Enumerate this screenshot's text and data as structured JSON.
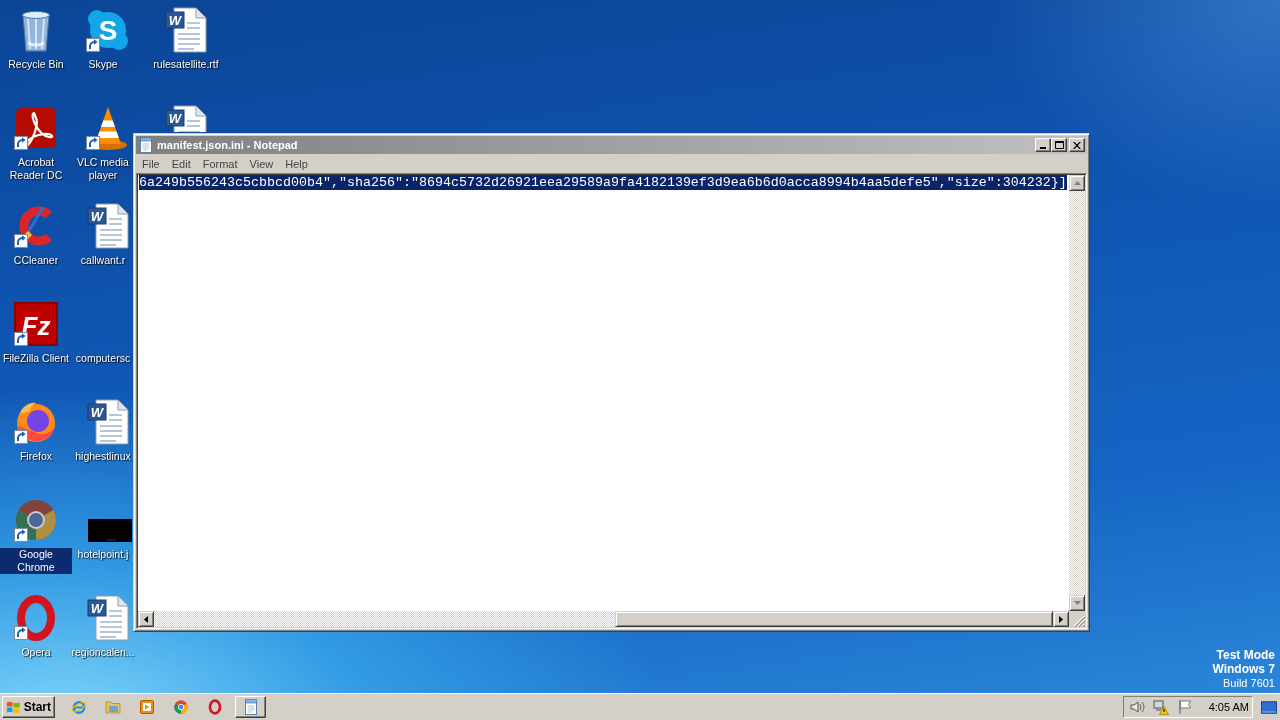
{
  "desktop": {
    "columns": [
      [
        {
          "label": "Recycle Bin",
          "selected": false,
          "shortcut": false
        },
        {
          "label": "Acrobat Reader DC",
          "selected": false,
          "shortcut": true
        },
        {
          "label": "CCleaner",
          "selected": false,
          "shortcut": true
        },
        {
          "label": "FileZilla Client",
          "selected": false,
          "shortcut": true,
          "logo_text": "Fz"
        },
        {
          "label": "Firefox",
          "selected": false,
          "shortcut": true
        },
        {
          "label": "Google Chrome",
          "selected": true,
          "shortcut": true
        },
        {
          "label": "Opera",
          "selected": false,
          "shortcut": true
        }
      ],
      [
        {
          "label": "Skype",
          "selected": false,
          "shortcut": true,
          "logo_text": "S"
        },
        {
          "label": "VLC media player",
          "selected": false,
          "shortcut": true
        },
        {
          "label": "callwant.r",
          "selected": false,
          "shortcut": false,
          "logo_text": "W"
        },
        {
          "label": "computersc",
          "selected": false,
          "shortcut": false
        },
        {
          "label": "highestlinux",
          "selected": false,
          "shortcut": false,
          "logo_text": "W"
        },
        {
          "label": "hotelpoint.j",
          "selected": false,
          "shortcut": false
        },
        {
          "label": "regioncalen...",
          "selected": false,
          "shortcut": false,
          "logo_text": "W"
        }
      ],
      [
        {
          "label": "rulesatellite.rtf",
          "selected": false,
          "shortcut": false,
          "logo_text": "W"
        },
        {
          "selected": false,
          "shortcut": false,
          "logo_text": "W"
        }
      ]
    ],
    "notice": {
      "title_lines": [
        "Test Mode",
        "Windows 7"
      ],
      "build": "Build 7601"
    }
  },
  "window": {
    "title": "manifest.json.ini - Notepad",
    "active": false,
    "menu": [
      "File",
      "Edit",
      "Format",
      "View",
      "Help"
    ],
    "lines": [
      {
        "text": "6a249b556243c5cbbcd00b4\",\"sha256\":\"8694c5732d26921eea29589a9fa4182139ef3d9ea6b6d0acca8994b4aa5defe5\",\"size\":304232}]",
        "selected": true
      }
    ]
  },
  "taskbar": {
    "start_label": "Start",
    "clock": "4:05 AM"
  }
}
